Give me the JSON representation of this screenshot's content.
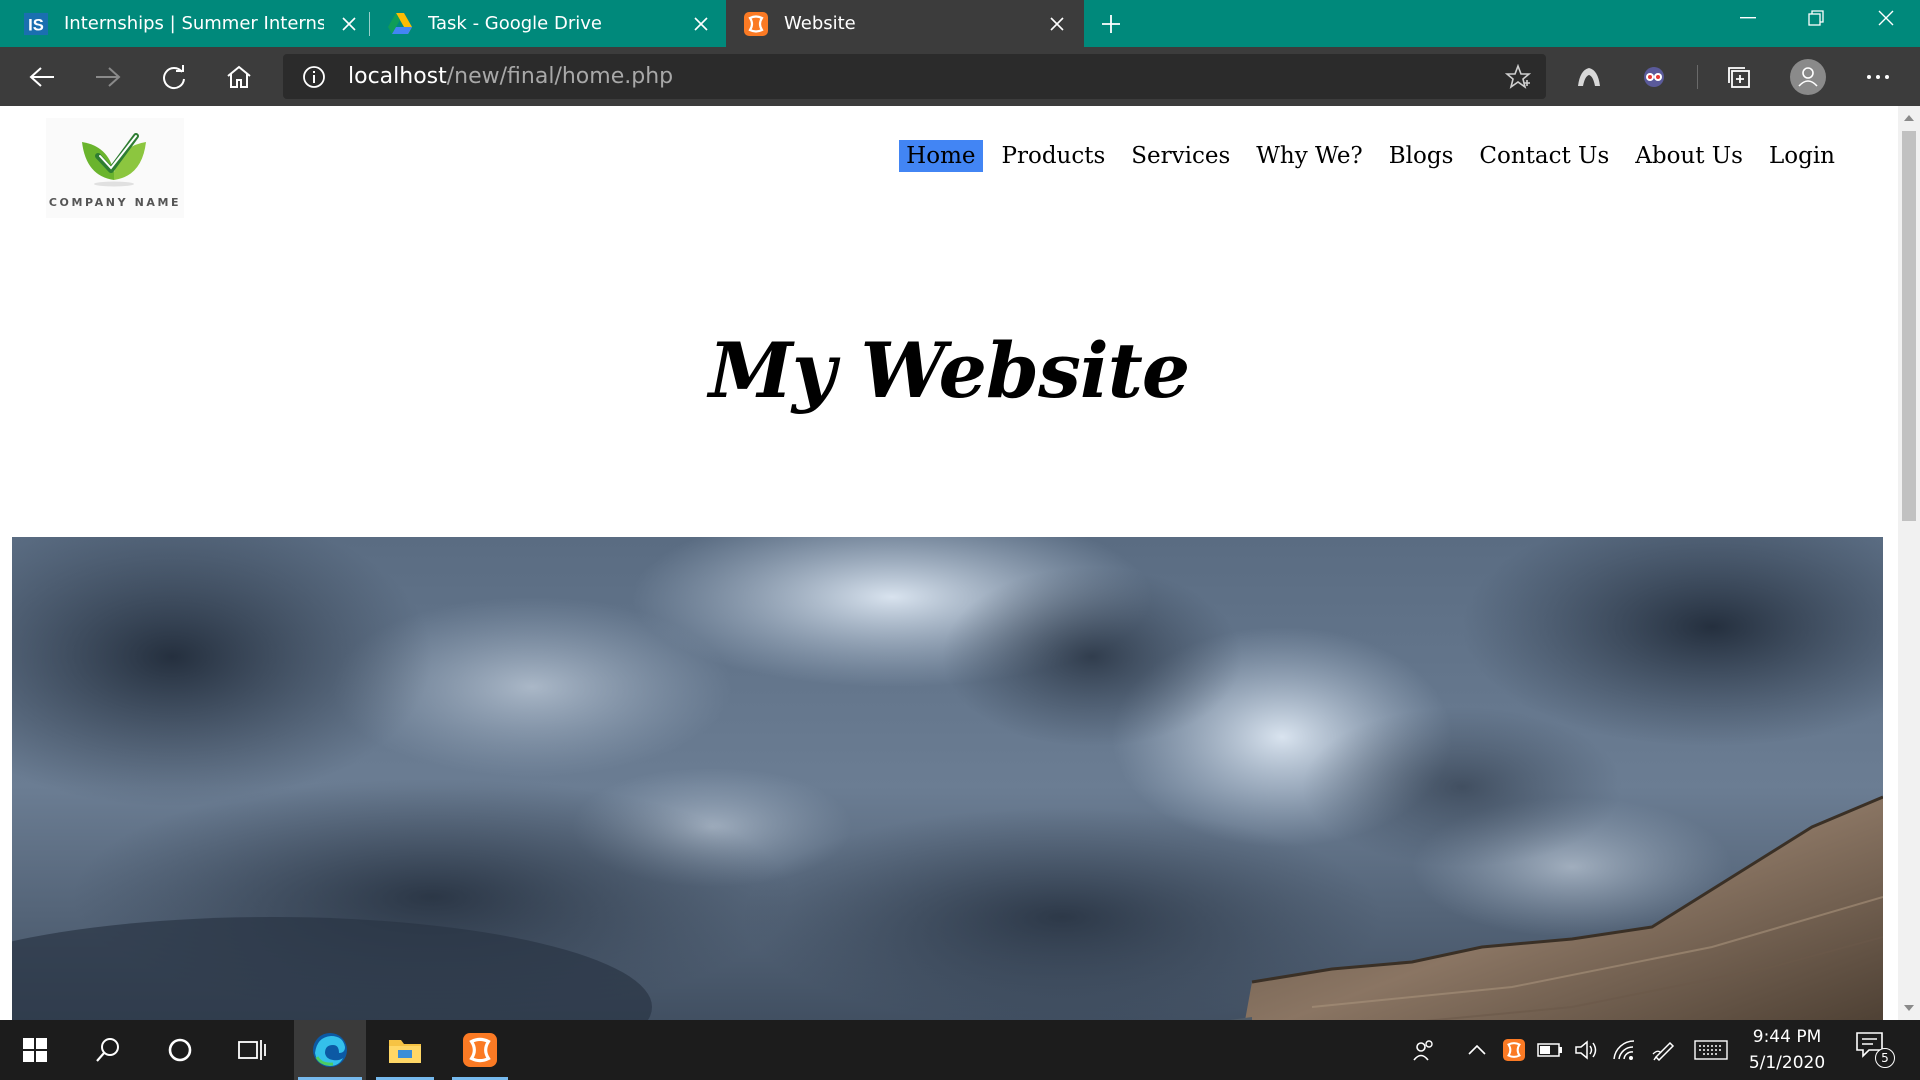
{
  "browser": {
    "tabs": [
      {
        "title": "Internships | Summer Internship",
        "icon": "internshala-icon"
      },
      {
        "title": "Task - Google Drive",
        "icon": "google-drive-icon"
      },
      {
        "title": "Website",
        "icon": "xampp-icon"
      }
    ],
    "address": {
      "host": "localhost",
      "path": "/new/final/home.php"
    }
  },
  "page": {
    "logo_text": "COMPANY NAME",
    "nav": [
      "Home",
      "Products",
      "Services",
      "Why We?",
      "Blogs",
      "Contact Us",
      "About Us",
      "Login"
    ],
    "active_nav": "Home",
    "hero_title": "My Website",
    "banner": "stormy sky over coastal cliffs"
  },
  "taskbar": {
    "time": "9:44 PM",
    "date": "5/1/2020",
    "notifications": "5"
  },
  "colors": {
    "tab_bar": "#00897b",
    "toolbar": "#3c3c3c",
    "active_nav": "#4285f4",
    "taskbar": "#1c1c1c"
  }
}
